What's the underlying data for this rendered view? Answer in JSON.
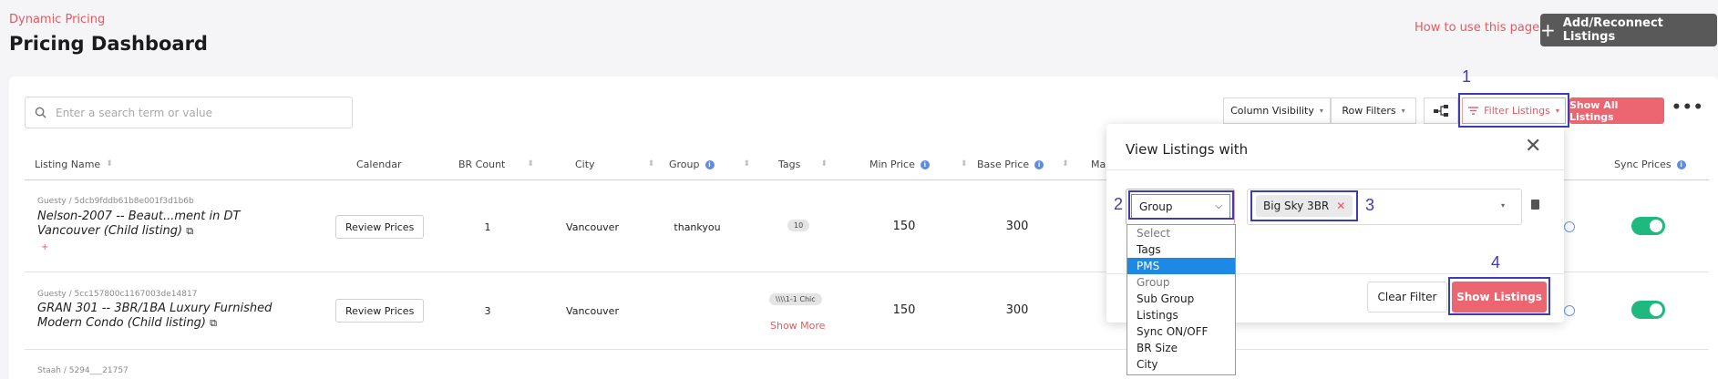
{
  "header": {
    "breadcrumb": "Dynamic Pricing",
    "title": "Pricing Dashboard",
    "how_to_link": "How to use this page?",
    "add_button": "Add/Reconnect Listings"
  },
  "toolbar": {
    "search_placeholder": "Enter a search term or value",
    "column_visibility": "Column Visibility",
    "row_filters": "Row Filters",
    "filter_listings": "Filter Listings",
    "show_all_listings": "Show All Listings",
    "more": "•••"
  },
  "table": {
    "columns": {
      "listing_name": "Listing Name",
      "calendar": "Calendar",
      "br_count": "BR Count",
      "city": "City",
      "group": "Group",
      "tags": "Tags",
      "min_price": "Min Price",
      "base_price": "Base Price",
      "max_partial": "Ma",
      "sync_prices": "Sync Prices"
    },
    "review_label": "Review Prices",
    "rows": [
      {
        "source": "Guesty / 5dcb9fddb61b8e001f3d1b6b",
        "name": "Nelson-2007 -- Beaut...ment in DT Vancouver (Child listing)",
        "br": "1",
        "city": "Vancouver",
        "group": "thankyou",
        "tag": "10",
        "min": "150",
        "base": "300",
        "extra": "+"
      },
      {
        "source": "Guesty / 5cc157800c1167003de14817",
        "name": "GRAN 301 -- 3BR/1BA Luxury Furnished Modern Condo (Child listing)",
        "br": "3",
        "city": "Vancouver",
        "tag": "\\\\\\\\1-1 Chic",
        "show_more": "Show More",
        "min": "150",
        "base": "300"
      },
      {
        "source": "Staah / 5294___21757"
      }
    ]
  },
  "popup": {
    "title": "View Listings with",
    "close": "✕",
    "selected_filter": "Group",
    "chip": "Big Sky 3BR",
    "clear_button": "Clear Filter",
    "show_button": "Show Listings",
    "options": [
      "Select",
      "Tags",
      "PMS",
      "Group",
      "Sub Group",
      "Listings",
      "Sync ON/OFF",
      "BR Size",
      "City"
    ]
  },
  "annotations": [
    "1",
    "2",
    "3",
    "4"
  ],
  "colors": {
    "accent": "#ec6672",
    "annotation": "#3c3cb4",
    "toggle_on": "#1fb87f",
    "dropdown_highlight": "#1e88e5"
  }
}
